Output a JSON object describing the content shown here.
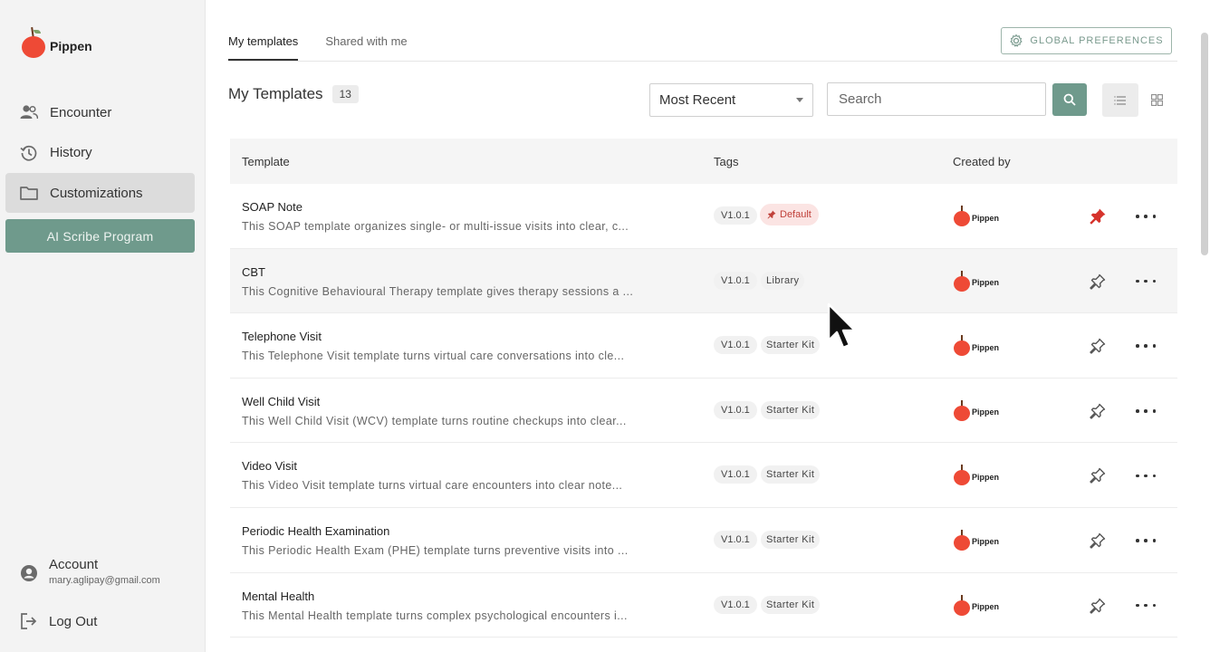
{
  "brand": {
    "name": "Pippen",
    "color": "#ee4a36",
    "accent": "#6f9a8c"
  },
  "sidebar": {
    "items": [
      {
        "label": "Encounter",
        "icon": "users-icon"
      },
      {
        "label": "History",
        "icon": "history-icon"
      },
      {
        "label": "Customizations",
        "icon": "folder-icon",
        "active": true
      }
    ],
    "program_button": "AI Scribe Program",
    "account": {
      "label": "Account",
      "email": "mary.aglipay@gmail.com"
    },
    "logout": "Log Out"
  },
  "tabs": [
    {
      "label": "My templates",
      "active": true
    },
    {
      "label": "Shared with me"
    }
  ],
  "global_preferences": "GLOBAL PREFERENCES",
  "heading": {
    "title": "My Templates",
    "count": "13"
  },
  "sort": {
    "selected": "Most Recent"
  },
  "search": {
    "placeholder": "Search"
  },
  "table": {
    "headers": {
      "template": "Template",
      "tags": "Tags",
      "created_by": "Created by"
    },
    "rows": [
      {
        "title": "SOAP Note",
        "desc": "This SOAP template organizes single- or multi-issue visits into clear, c...",
        "version": "V1.0.1",
        "tag": "Default",
        "creator": "Pippen",
        "pinned": true
      },
      {
        "title": "CBT",
        "desc": "This Cognitive Behavioural Therapy template gives therapy sessions a ...",
        "version": "V1.0.1",
        "tag": "Library",
        "creator": "Pippen",
        "pinned": false
      },
      {
        "title": "Telephone Visit",
        "desc": "This Telephone Visit template turns virtual care conversations into cle...",
        "version": "V1.0.1",
        "tag": "Starter Kit",
        "creator": "Pippen",
        "pinned": false
      },
      {
        "title": "Well Child Visit",
        "desc": "This Well Child Visit (WCV) template turns routine checkups into clear...",
        "version": "V1.0.1",
        "tag": "Starter Kit",
        "creator": "Pippen",
        "pinned": false
      },
      {
        "title": "Video Visit",
        "desc": "This Video Visit template turns virtual care encounters into clear note...",
        "version": "V1.0.1",
        "tag": "Starter Kit",
        "creator": "Pippen",
        "pinned": false
      },
      {
        "title": "Periodic Health Examination",
        "desc": "This Periodic Health Exam (PHE) template turns preventive visits into ...",
        "version": "V1.0.1",
        "tag": "Starter Kit",
        "creator": "Pippen",
        "pinned": false
      },
      {
        "title": "Mental Health",
        "desc": "This Mental Health template turns complex psychological encounters i...",
        "version": "V1.0.1",
        "tag": "Starter Kit",
        "creator": "Pippen",
        "pinned": false
      }
    ]
  }
}
